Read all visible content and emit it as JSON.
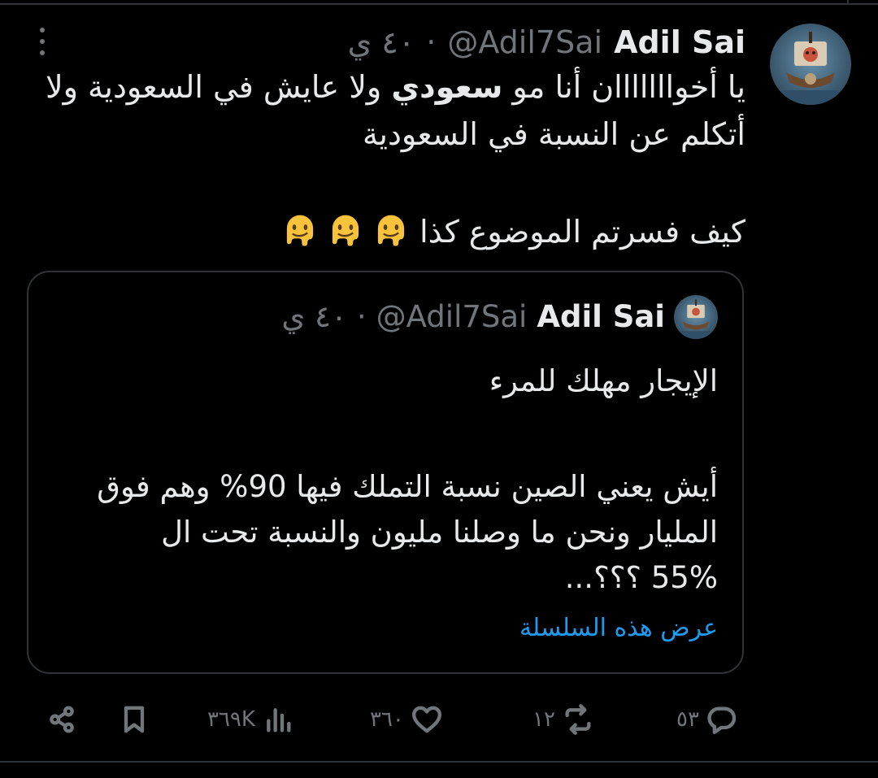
{
  "tweet": {
    "author_name": "Adil Sai",
    "handle": "@Adil7Sai",
    "separator": "·",
    "time": "٤٠ ي",
    "text_line1": "يا أخوااااااان أنا مو ",
    "text_bold": "سعودي",
    "text_line1_rest": " ولا عايش في السعودية ولا",
    "text_line2": "أتكلم عن النسبة في السعودية",
    "text_line3": "كيف فسرتم الموضوع كذا",
    "emoji_name": "melting-face"
  },
  "quoted": {
    "author_name": "Adil Sai",
    "handle": "@Adil7Sai",
    "separator": "·",
    "time": "٤٠ ي",
    "line1": "الإيجار مهلك للمرء",
    "line2": "أيش يعني الصين نسبة التملك فيها 90% وهم فوق",
    "line3": "المليار ونحن ما وصلنا مليون والنسبة تحت ال",
    "line4": "55% ؟؟؟...",
    "show_thread": "عرض هذه السلسلة"
  },
  "actions": {
    "replies": "٥٣",
    "reposts": "١٢",
    "likes": "٣٦٠",
    "views": "٣٦٩K"
  },
  "colors": {
    "background": "#000000",
    "text": "#e7e9ea",
    "muted": "#71767b",
    "link": "#1d9bf0",
    "border": "#2f3336"
  }
}
